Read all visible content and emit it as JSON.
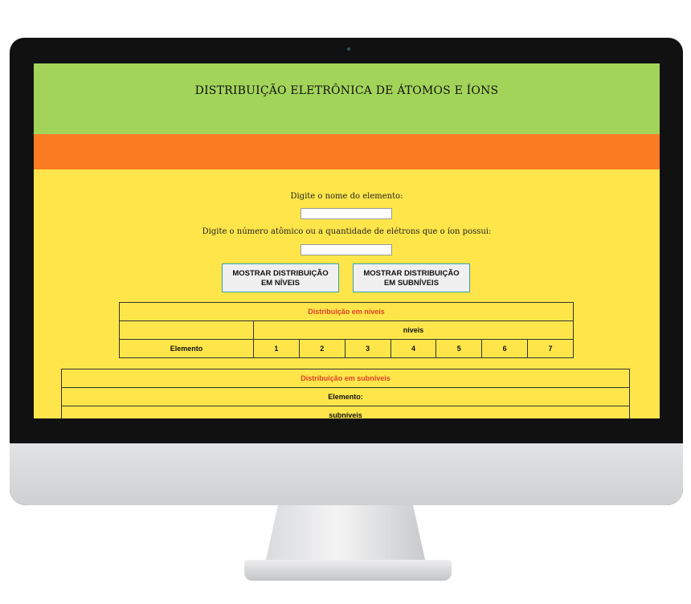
{
  "header": {
    "title": "DISTRIBUIÇÃO ELETRÔNICA DE ÁTOMOS E ÍONS"
  },
  "form": {
    "element_label": "Digite o nome do elemento:",
    "element_value": "",
    "number_label": "Digite o número atômico ou a quantidade de elétrons que o íon possui:",
    "number_value": ""
  },
  "buttons": {
    "levels_line1": "MOSTRAR DISTRIBUIÇÃO",
    "levels_line2": "EM NÍVEIS",
    "sublevels_line1": "MOSTRAR DISTRIBUIÇÃO",
    "sublevels_line2": "EM SUBNÍVEIS"
  },
  "levels_table": {
    "caption": "Distribuição em níveis",
    "group_header": "níveis",
    "row_label": "Elemento",
    "levels": [
      "1",
      "2",
      "3",
      "4",
      "5",
      "6",
      "7"
    ]
  },
  "sublevels_table": {
    "caption": "Distribuição em subníveis",
    "element_row": "Elemento:",
    "group_header": "subníveis"
  },
  "colors": {
    "header_green": "#a3d45a",
    "band_orange": "#fb7b23",
    "page_yellow": "#fee64a",
    "caption_red": "#e0402a",
    "button_border": "#35a0b4"
  }
}
